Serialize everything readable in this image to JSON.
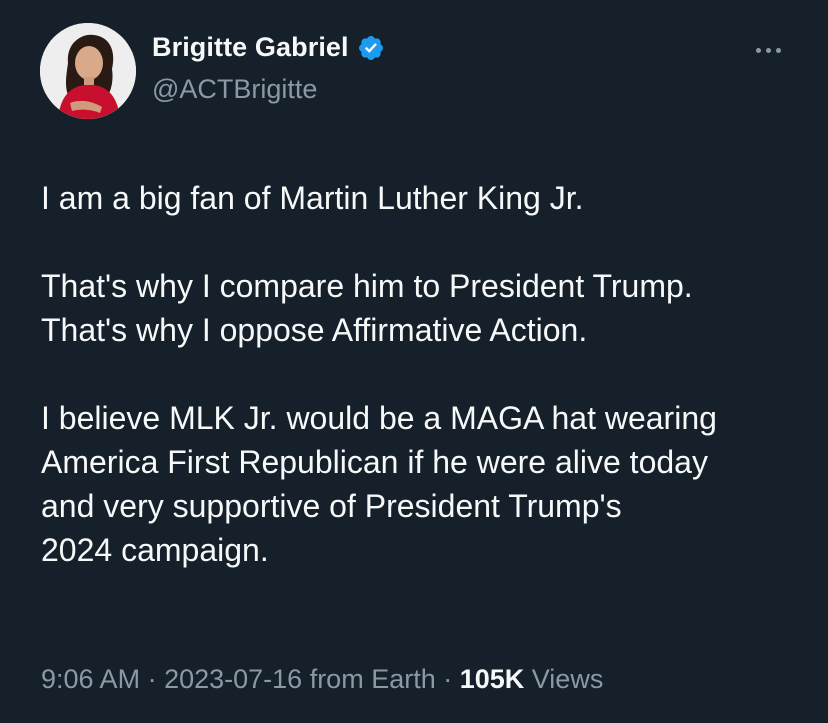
{
  "author": {
    "display_name": "Brigitte Gabriel",
    "handle": "@ACTBrigitte",
    "verified_icon": "verified-badge-icon",
    "avatar": "profile-photo"
  },
  "menu": {
    "icon": "more-options-icon"
  },
  "tweet": {
    "lines": [
      "I am a big fan of Martin Luther King Jr.",
      "",
      "That's why I compare him to President Trump.",
      "That's why I oppose Affirmative Action.",
      "",
      "I believe MLK Jr. would be a MAGA hat wearing",
      "America First Republican if he were alive today",
      "and very supportive of President Trump's",
      "2024 campaign."
    ]
  },
  "meta": {
    "time": "9:06 AM",
    "sep1": " · ",
    "date": "2023-07-16",
    "source": " from Earth",
    "sep2": " · ",
    "views_count": "105K",
    "views_label": " Views"
  },
  "colors": {
    "background": "#15202b",
    "text_primary": "#f7f9f9",
    "text_secondary": "#8b98a5",
    "verified": "#1d9bf0"
  }
}
